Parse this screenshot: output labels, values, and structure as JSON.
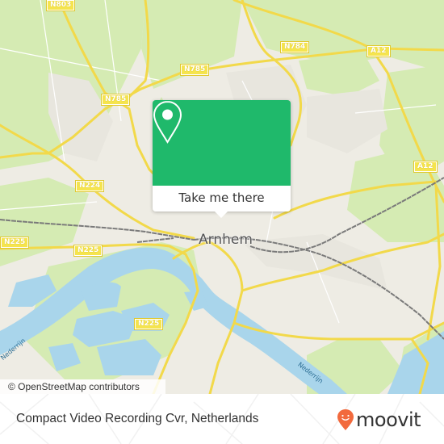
{
  "map": {
    "city_label": "Arnhem",
    "road_labels": [
      {
        "id": "n803",
        "text": "N803"
      },
      {
        "id": "n785-a",
        "text": "N785"
      },
      {
        "id": "n785-b",
        "text": "N785"
      },
      {
        "id": "n784",
        "text": "N784"
      },
      {
        "id": "a12-a",
        "text": "A12"
      },
      {
        "id": "a12-b",
        "text": "A12"
      },
      {
        "id": "n224",
        "text": "N224"
      },
      {
        "id": "n225-a",
        "text": "N225"
      },
      {
        "id": "n225-b",
        "text": "N225"
      },
      {
        "id": "n225-c",
        "text": "N225"
      }
    ],
    "water_labels": [
      {
        "id": "nederrijn-west",
        "text": "Nederrijn"
      },
      {
        "id": "nederrijn-east",
        "text": "Nederrijn"
      }
    ],
    "attribution": "© OpenStreetMap contributors",
    "colors": {
      "land": "#eeece4",
      "green": "#d4eab0",
      "water": "#a8d4ea",
      "road": "#f5e44e",
      "rail": "#777777"
    }
  },
  "popup": {
    "icon": "map-pin-icon",
    "button_label": "Take me there",
    "color": "#1fb96b"
  },
  "footer": {
    "place_name": "Compact Video Recording Cvr, Netherlands",
    "brand": "moovit",
    "brand_color": "#f26a3d"
  }
}
